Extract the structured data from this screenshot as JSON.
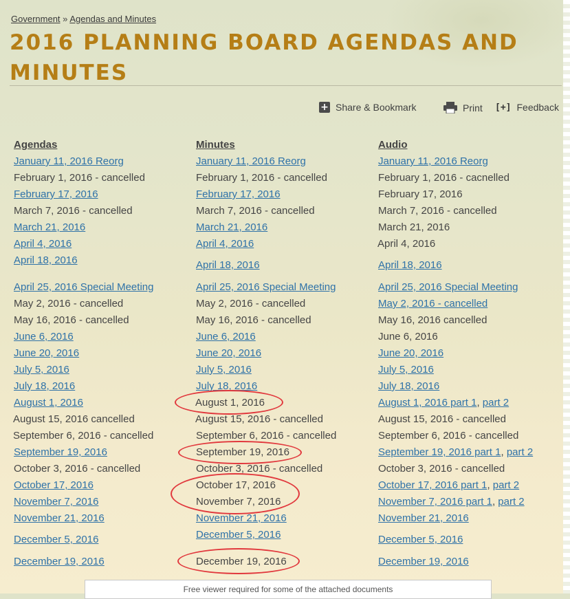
{
  "breadcrumb": {
    "parent": "Government",
    "separator": "»",
    "current": "Agendas and Minutes"
  },
  "page": {
    "title": "2016 PLANNING BOARD AGENDAS AND MINUTES"
  },
  "toolbar": {
    "share": "Share & Bookmark",
    "print": "Print",
    "feedback": "Feedback",
    "feedback_glyph": "[+]"
  },
  "columns": [
    {
      "header": "Agendas",
      "rows": [
        {
          "text": "January 11, 2016 Reorg",
          "link": true
        },
        {
          "text": "February 1, 2016 - cancelled",
          "link": false
        },
        {
          "text": "February 17, 2016",
          "link": true
        },
        {
          "text": "March 7, 2016 - cancelled",
          "link": false
        },
        {
          "text": "March 21, 2016",
          "link": true
        },
        {
          "text": "April 4, 2016",
          "link": true
        },
        {
          "text": "April 18, 2016",
          "link": true
        },
        {
          "text": "April 25, 2016 Special Meeting",
          "link": true
        },
        {
          "text": "May 2, 2016 - cancelled",
          "link": false
        },
        {
          "text": "May 16, 2016 - cancelled",
          "link": false
        },
        {
          "text": "June 6, 2016",
          "link": true
        },
        {
          "text": "June 20, 2016",
          "link": true
        },
        {
          "text": "July 5, 2016",
          "link": true
        },
        {
          "text": "July 18, 2016",
          "link": true
        },
        {
          "text": "August 1, 2016",
          "link": true
        },
        {
          "text": "August 15, 2016 cancelled",
          "link": false
        },
        {
          "text": "September 6, 2016 - cancelled",
          "link": false
        },
        {
          "text": "September 19, 2016",
          "link": true
        },
        {
          "text": "October 3, 2016 - cancelled",
          "link": false
        },
        {
          "text": "October 17, 2016",
          "link": true
        },
        {
          "text": "November 7, 2016",
          "link": true
        },
        {
          "text": "November 21, 2016",
          "link": true
        },
        {
          "text": "December 5, 2016",
          "link": true
        },
        {
          "text": "December 19, 2016",
          "link": true
        }
      ]
    },
    {
      "header": "Minutes",
      "rows": [
        {
          "text": "January 11, 2016 Reorg",
          "link": true
        },
        {
          "text": "February 1, 2016 - cancelled",
          "link": false
        },
        {
          "text": "February 17, 2016",
          "link": true
        },
        {
          "text": "March 7, 2016 - cancelled",
          "link": false
        },
        {
          "text": "March 21, 2016",
          "link": true
        },
        {
          "text": "April 4, 2016",
          "link": true
        },
        {
          "text": "April 18, 2016",
          "link": true
        },
        {
          "text": "April 25, 2016 Special Meeting",
          "link": true
        },
        {
          "text": "May 2, 2016 - cancelled",
          "link": false
        },
        {
          "text": "May 16, 2016 - cancelled",
          "link": false
        },
        {
          "text": "June 6, 2016",
          "link": true
        },
        {
          "text": "June 20, 2016",
          "link": true
        },
        {
          "text": "July 5, 2016",
          "link": true
        },
        {
          "text": "July 18, 2016",
          "link": true
        },
        {
          "text": "August 1, 2016",
          "link": false
        },
        {
          "text": "August 15, 2016 - cancelled",
          "link": false
        },
        {
          "text": "September 6, 2016 - cancelled",
          "link": false
        },
        {
          "text": "September 19, 2016",
          "link": false
        },
        {
          "text": "October 3, 2016 - cancelled",
          "link": false
        },
        {
          "text": "October 17, 2016",
          "link": false
        },
        {
          "text": "November 7, 2016",
          "link": false
        },
        {
          "text": "November 21, 2016",
          "link": true
        },
        {
          "text": "December 5, 2016",
          "link": true
        },
        {
          "text": "December 19, 2016",
          "link": false
        }
      ]
    },
    {
      "header": "Audio",
      "rows": [
        {
          "text": "January 11, 2016 Reorg",
          "link": true
        },
        {
          "text": "February 1, 2016 - cacnelled",
          "link": false
        },
        {
          "text": "February 17, 2016",
          "link": false
        },
        {
          "text": "March 7, 2016 - cancelled",
          "link": false
        },
        {
          "text": "March 21, 2016",
          "link": false
        },
        {
          "text": "April 4, 2016",
          "link": false
        },
        {
          "text": "April 18, 2016",
          "link": true
        },
        {
          "text": "April 25, 2016 Special Meeting",
          "link": true
        },
        {
          "text": "May 2, 2016 - cancelled",
          "link": true
        },
        {
          "text": "May 16, 2016 cancelled",
          "link": false
        },
        {
          "text": "June 6, 2016",
          "link": false
        },
        {
          "text": "June 20, 2016",
          "link": true
        },
        {
          "text": "July 5, 2016",
          "link": true
        },
        {
          "text": "July 18, 2016",
          "link": true
        },
        {
          "text": "August 1, 2016 part 1",
          "link": true,
          "extra": "part 2"
        },
        {
          "text": "August 15, 2016 - cancelled",
          "link": false
        },
        {
          "text": "September 6, 2016 - cancelled",
          "link": false
        },
        {
          "text": "September 19, 2016 part 1",
          "link": true,
          "extra": "part 2"
        },
        {
          "text": "October 3, 2016 - cancelled",
          "link": false
        },
        {
          "text": "October 17, 2016 part 1",
          "link": true,
          "extra": "part 2"
        },
        {
          "text": "November 7, 2016 part 1",
          "link": true,
          "extra": "part 2"
        },
        {
          "text": "November 21, 2016",
          "link": true
        },
        {
          "text": "December 5, 2016",
          "link": true
        },
        {
          "text": "December 19, 2016",
          "link": true
        }
      ]
    }
  ],
  "colors": {
    "title": "#b57e16",
    "link": "#2f72a8",
    "annotation": "#e1383d"
  },
  "footer_note": "Free viewer required for some of the attached documents"
}
